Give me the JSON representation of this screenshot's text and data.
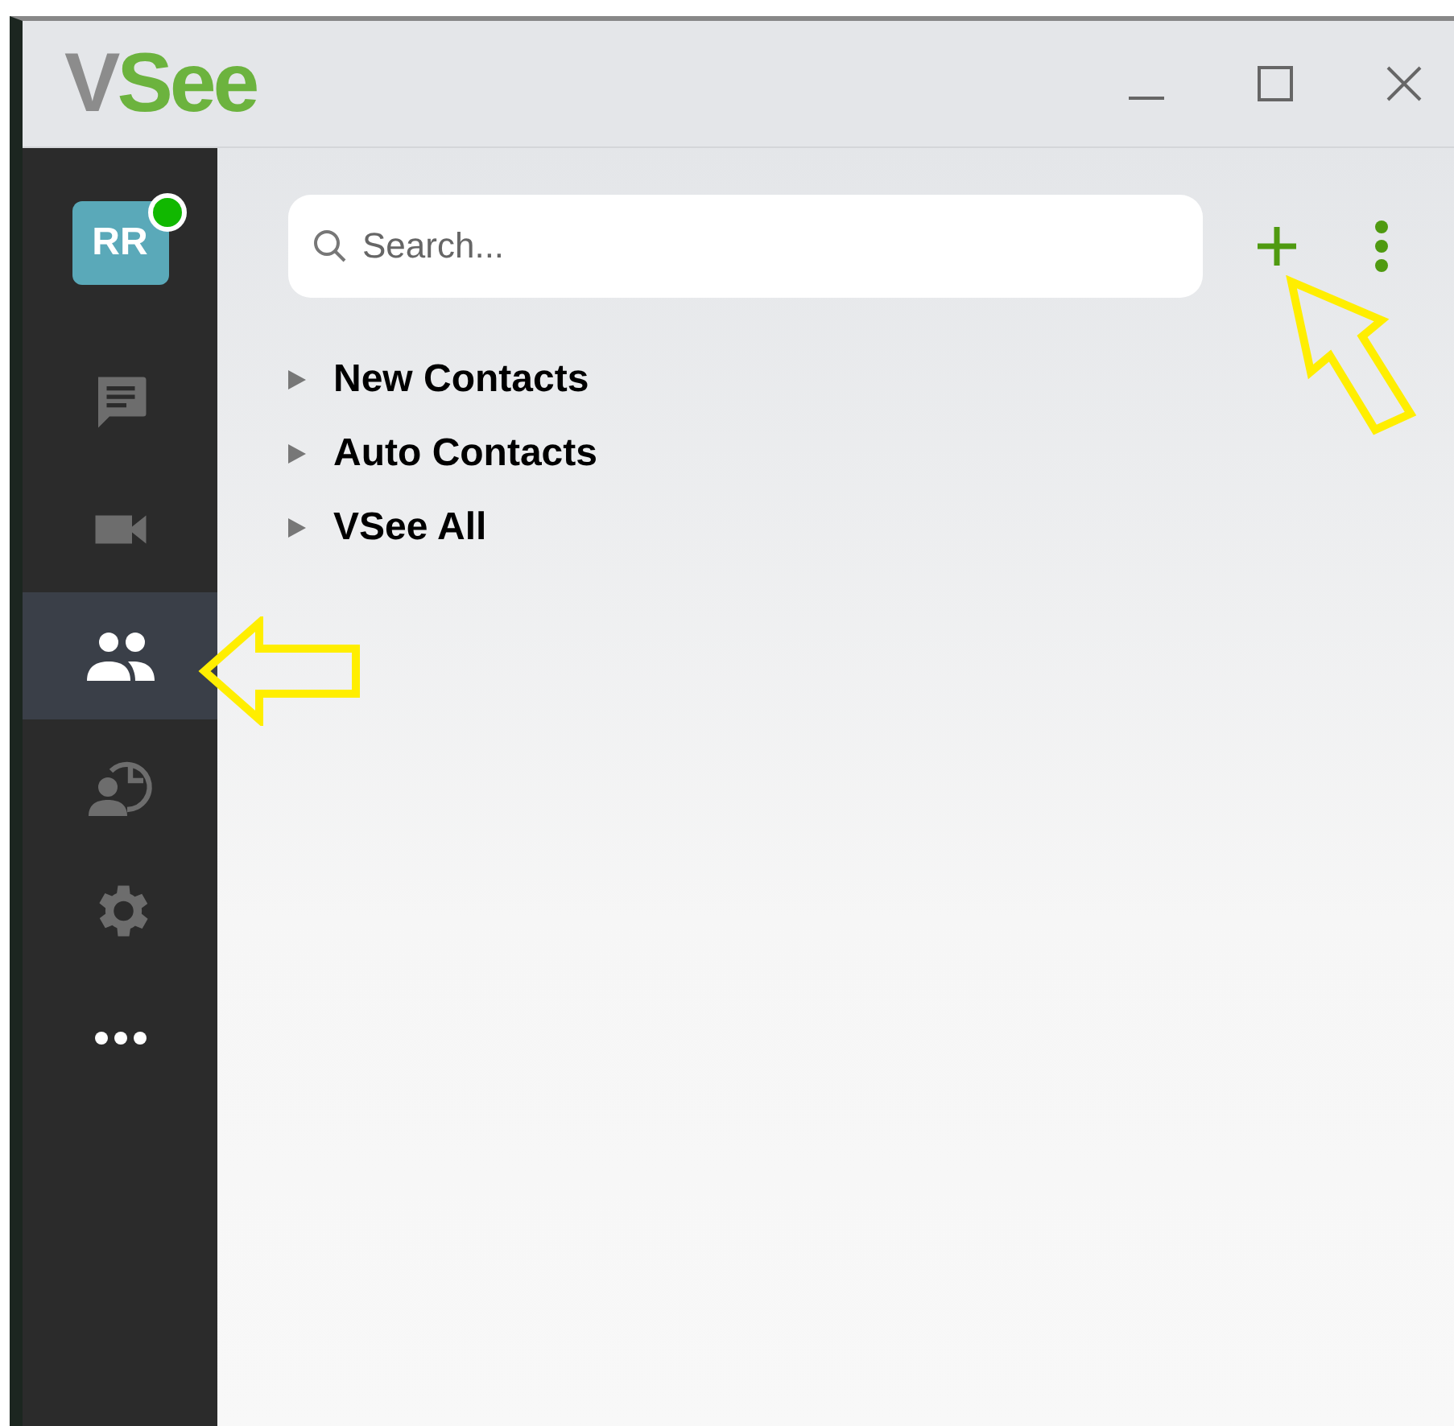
{
  "window": {
    "logo": [
      {
        "text": "V",
        "color": "#8c8c8c"
      },
      {
        "text": "See",
        "color": "#6cb33e"
      }
    ]
  },
  "sidebar": {
    "avatar": {
      "initials": "RR",
      "online": true
    },
    "items": [
      {
        "kind": "chat",
        "selected": false
      },
      {
        "kind": "video",
        "selected": false
      },
      {
        "kind": "contacts",
        "selected": true
      },
      {
        "kind": "history",
        "selected": false
      },
      {
        "kind": "settings",
        "selected": false
      },
      {
        "kind": "more",
        "selected": false
      }
    ]
  },
  "search": {
    "placeholder": "Search..."
  },
  "groups": [
    {
      "label": "New Contacts",
      "expanded": false
    },
    {
      "label": "Auto Contacts",
      "expanded": false
    },
    {
      "label": "VSee All",
      "expanded": false
    }
  ]
}
